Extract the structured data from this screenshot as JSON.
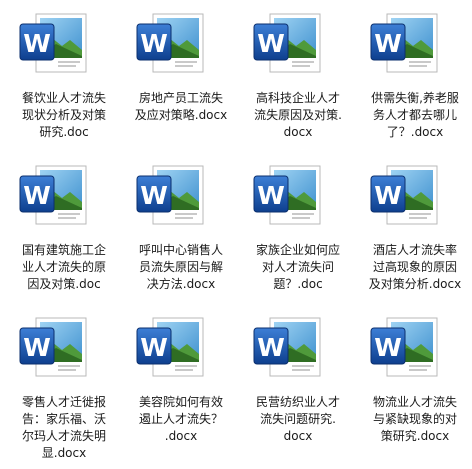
{
  "files": [
    {
      "name": "餐饮业人才流失现状分析及对策研究.doc",
      "type": "doc",
      "lines": [
        "餐饮业人才流失",
        "现状分析及对策",
        "研究.doc"
      ]
    },
    {
      "name": "房地产员工流失及应对策略.docx",
      "type": "docx",
      "lines": [
        "房地产员工流失",
        "及应对策略.docx"
      ]
    },
    {
      "name": "高科技企业人才流失原因及对策.docx",
      "type": "docx",
      "lines": [
        "高科技企业人才",
        "流失原因及对策.",
        "docx"
      ]
    },
    {
      "name": "供需失衡,养老服务人才都去哪儿了?.docx",
      "type": "docx",
      "lines": [
        "供需失衡,养老服",
        "务人才都去哪儿",
        "了？.docx"
      ]
    },
    {
      "name": "国有建筑施工企业人才流失的原因及对策.doc",
      "type": "doc",
      "lines": [
        "国有建筑施工企",
        "业人才流失的原",
        "因及对策.doc"
      ]
    },
    {
      "name": "呼叫中心销售人员流失原因与解决方法.docx",
      "type": "docx",
      "lines": [
        "呼叫中心销售人",
        "员流失原因与解",
        "决方法.docx"
      ]
    },
    {
      "name": "家族企业如何应对人才流失问题?.doc",
      "type": "doc",
      "lines": [
        "家族企业如何应",
        "对人才流失问",
        "题？.doc"
      ]
    },
    {
      "name": "酒店人才流失率过高现象的原因及对策分析.docx",
      "type": "docx",
      "lines": [
        "酒店人才流失率",
        "过高现象的原因",
        "及对策分析.docx"
      ]
    },
    {
      "name": "零售人才迁徙报告:家乐福、沃尔玛人才流失明显.docx",
      "type": "docx",
      "lines": [
        "零售人才迁徙报",
        "告：家乐福、沃",
        "尔玛人才流失明",
        "显.docx"
      ]
    },
    {
      "name": "美容院如何有效遏止人才流失?.docx",
      "type": "docx",
      "lines": [
        "美容院如何有效",
        "遏止人才流失？",
        ".docx"
      ]
    },
    {
      "name": "民营纺织业人才流失问题研究.docx",
      "type": "docx",
      "lines": [
        "民营纺织业人才",
        "流失问题研究.",
        "docx"
      ]
    },
    {
      "name": "物流业人才流失与紧缺现象的对策研究.docx",
      "type": "docx",
      "lines": [
        "物流业人才流失",
        "与紧缺现象的对",
        "策研究.docx"
      ]
    }
  ],
  "icon": "word-document-icon",
  "colors": {
    "word_blue": "#1d5fb8",
    "word_dark": "#0f3f8a"
  }
}
